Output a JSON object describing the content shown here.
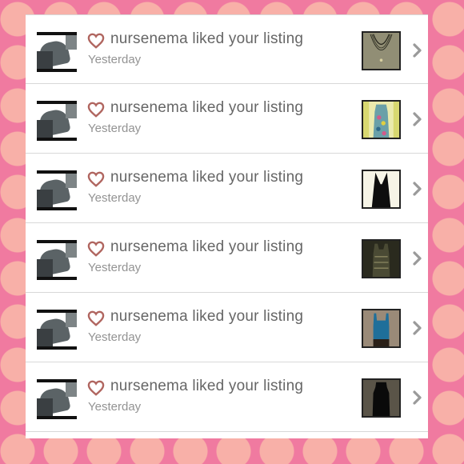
{
  "notifications": [
    {
      "actor": "nursenema",
      "message": "nursenema liked your listing",
      "time": "Yesterday",
      "heart_icon": "heart-outline-icon",
      "thumb": "necklace"
    },
    {
      "actor": "nursenema",
      "message": "nursenema liked your listing",
      "time": "Yesterday",
      "heart_icon": "heart-outline-icon",
      "thumb": "floral-dress"
    },
    {
      "actor": "nursenema",
      "message": "nursenema liked your listing",
      "time": "Yesterday",
      "heart_icon": "heart-outline-icon",
      "thumb": "black-dress"
    },
    {
      "actor": "nursenema",
      "message": "nursenema liked your listing",
      "time": "Yesterday",
      "heart_icon": "heart-outline-icon",
      "thumb": "lace-top"
    },
    {
      "actor": "nursenema",
      "message": "nursenema liked your listing",
      "time": "Yesterday",
      "heart_icon": "heart-outline-icon",
      "thumb": "blue-tank"
    },
    {
      "actor": "nursenema",
      "message": "nursenema liked your listing",
      "time": "Yesterday",
      "heart_icon": "heart-outline-icon",
      "thumb": "black-halter-top"
    }
  ],
  "colors": {
    "heart": "#b0655f",
    "chevron": "#9a9a9a",
    "background_pink": "#f07aa0",
    "background_dot": "#f8b0a8"
  }
}
